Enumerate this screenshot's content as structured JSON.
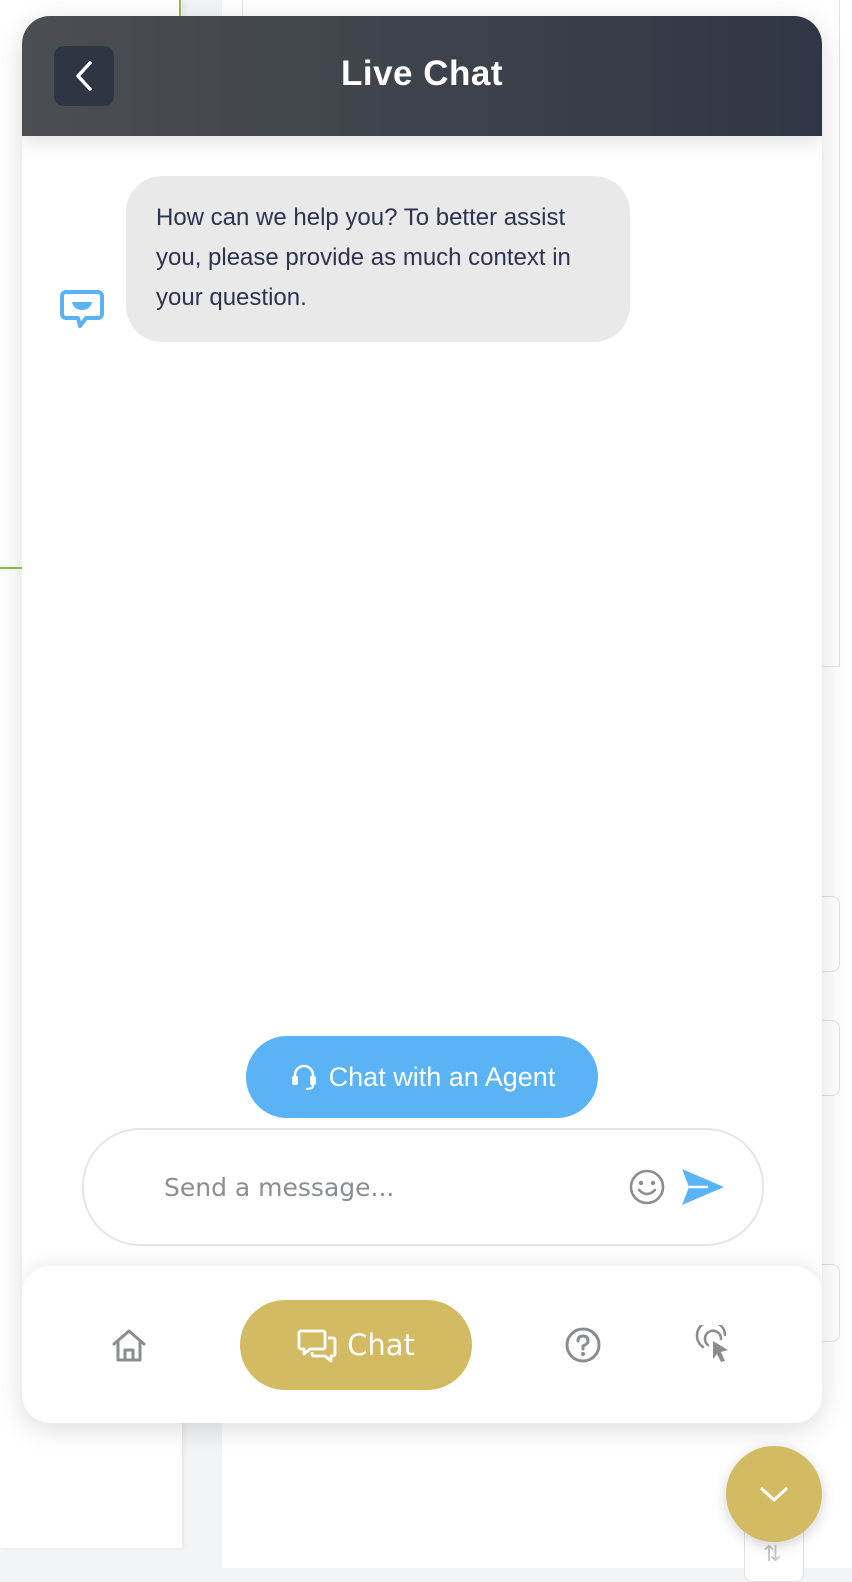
{
  "header": {
    "title": "Live Chat"
  },
  "messages": [
    {
      "sender": "bot",
      "text": "How can we help you? To better assist you, please provide as much context in your question."
    }
  ],
  "agent_button": {
    "label": "Chat with an Agent"
  },
  "composer": {
    "placeholder": "Send a message..."
  },
  "bottom_nav": {
    "items": [
      {
        "icon": "home-icon",
        "label": ""
      },
      {
        "icon": "chat-bubbles-icon",
        "label": "Chat",
        "active": true
      },
      {
        "icon": "help-icon",
        "label": ""
      },
      {
        "icon": "pointer-click-icon",
        "label": ""
      }
    ]
  },
  "colors": {
    "accent_gold": "#d3bb63",
    "agent_blue": "#5ab3f5",
    "header_dark": "#2f3645",
    "bubble_gray": "#e9e9ea"
  }
}
